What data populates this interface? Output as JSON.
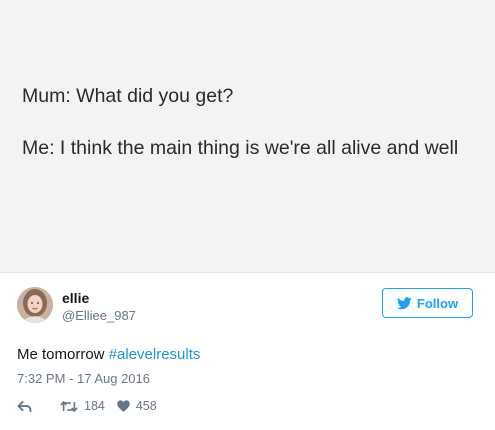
{
  "meme": {
    "line1": "Mum: What did you get?",
    "line2": "Me: I think the main thing is we're all alive and well"
  },
  "author": {
    "name": "ellie",
    "handle": "@Elliee_987",
    "avatar_icon": "profile-photo"
  },
  "follow": {
    "label": "Follow",
    "icon": "twitter-bird-icon",
    "color": "#1da1f2"
  },
  "tweet": {
    "text": "Me tomorrow ",
    "hashtag": "#alevelresults",
    "timestamp": "7:32 PM - 17 Aug 2016",
    "hashtag_color": "#1b95e0"
  },
  "actions": {
    "reply_icon": "reply-icon",
    "retweet_icon": "retweet-icon",
    "like_icon": "heart-icon",
    "retweets": "184",
    "likes": "458"
  }
}
